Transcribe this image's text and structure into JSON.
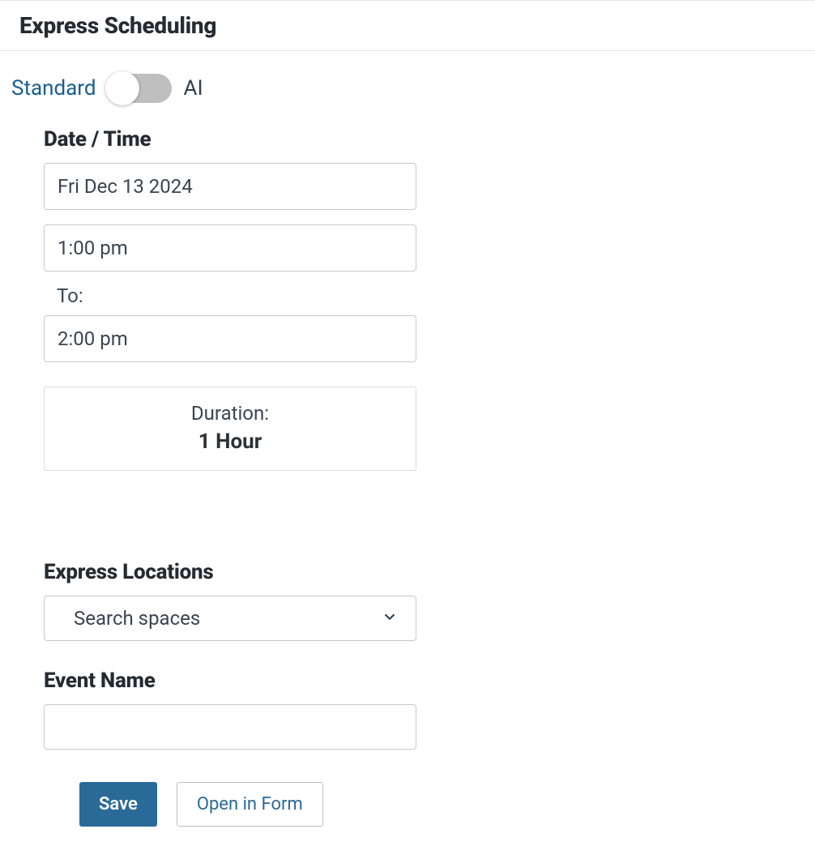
{
  "header": {
    "title": "Express Scheduling"
  },
  "mode": {
    "standard_label": "Standard",
    "ai_label": "AI",
    "active": "standard"
  },
  "datetime": {
    "heading": "Date / Time",
    "date_value": "Fri Dec 13 2024",
    "start_time_value": "1:00 pm",
    "to_label": "To:",
    "end_time_value": "2:00 pm",
    "duration_label": "Duration:",
    "duration_value": "1 Hour"
  },
  "locations": {
    "heading": "Express Locations",
    "placeholder": "Search spaces"
  },
  "event_name": {
    "heading": "Event Name",
    "value": ""
  },
  "buttons": {
    "save": "Save",
    "open_in_form": "Open in Form"
  }
}
